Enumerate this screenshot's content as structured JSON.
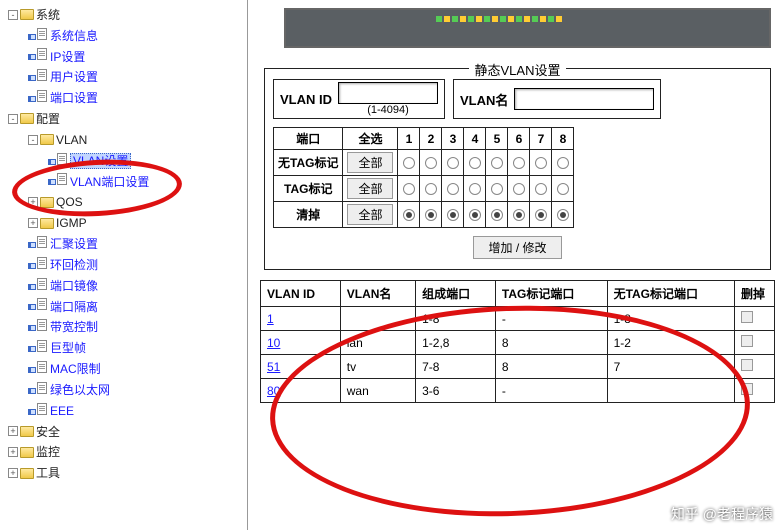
{
  "sidebar": {
    "nodes": [
      {
        "lvl": 0,
        "type": "folder",
        "toggle": "-",
        "label": "系统"
      },
      {
        "lvl": 1,
        "type": "page",
        "label": "系统信息"
      },
      {
        "lvl": 1,
        "type": "page",
        "label": "IP设置"
      },
      {
        "lvl": 1,
        "type": "page",
        "label": "用户设置"
      },
      {
        "lvl": 1,
        "type": "page",
        "label": "端口设置"
      },
      {
        "lvl": 0,
        "type": "folder",
        "toggle": "-",
        "label": "配置"
      },
      {
        "lvl": 1,
        "type": "folder",
        "toggle": "-",
        "label": "VLAN"
      },
      {
        "lvl": 2,
        "type": "page",
        "label": "VLAN设置",
        "selected": true
      },
      {
        "lvl": 2,
        "type": "page",
        "label": "VLAN端口设置"
      },
      {
        "lvl": 1,
        "type": "folder",
        "toggle": "+",
        "label": "QOS"
      },
      {
        "lvl": 1,
        "type": "folder",
        "toggle": "+",
        "label": "IGMP"
      },
      {
        "lvl": 1,
        "type": "page",
        "label": "汇聚设置"
      },
      {
        "lvl": 1,
        "type": "page",
        "label": "环回检测"
      },
      {
        "lvl": 1,
        "type": "page",
        "label": "端口镜像"
      },
      {
        "lvl": 1,
        "type": "page",
        "label": "端口隔离"
      },
      {
        "lvl": 1,
        "type": "page",
        "label": "带宽控制"
      },
      {
        "lvl": 1,
        "type": "page",
        "label": "巨型帧"
      },
      {
        "lvl": 1,
        "type": "page",
        "label": "MAC限制"
      },
      {
        "lvl": 1,
        "type": "page",
        "label": "绿色以太网"
      },
      {
        "lvl": 1,
        "type": "page",
        "label": "EEE"
      },
      {
        "lvl": 0,
        "type": "folder",
        "toggle": "+",
        "label": "安全"
      },
      {
        "lvl": 0,
        "type": "folder",
        "toggle": "+",
        "label": "监控"
      },
      {
        "lvl": 0,
        "type": "folder",
        "toggle": "+",
        "label": "工具"
      }
    ]
  },
  "panel": {
    "title": "静态VLAN设置",
    "vlanIdLabel": "VLAN ID",
    "vlanIdRange": "(1-4094)",
    "vlanNameLabel": "VLAN名",
    "portHeader": "端口",
    "selectAll": "全选",
    "ports": [
      "1",
      "2",
      "3",
      "4",
      "5",
      "6",
      "7",
      "8"
    ],
    "rows": [
      {
        "label": "无TAG标记",
        "btn": "全部",
        "checked": []
      },
      {
        "label": "TAG标记",
        "btn": "全部",
        "checked": []
      },
      {
        "label": "清掉",
        "btn": "全部",
        "checked": [
          "1",
          "2",
          "3",
          "4",
          "5",
          "6",
          "7",
          "8"
        ]
      }
    ],
    "addBtn": "增加 / 修改"
  },
  "list": {
    "headers": [
      "VLAN ID",
      "VLAN名",
      "组成端口",
      "TAG标记端口",
      "无TAG标记端口",
      "删掉"
    ],
    "rows": [
      {
        "id": "1",
        "name": "",
        "members": "1-8",
        "tag": "-",
        "untag": "1-8"
      },
      {
        "id": "10",
        "name": "lan",
        "members": "1-2,8",
        "tag": "8",
        "untag": "1-2"
      },
      {
        "id": "51",
        "name": "tv",
        "members": "7-8",
        "tag": "8",
        "untag": "7"
      },
      {
        "id": "80",
        "name": "wan",
        "members": "3-6",
        "tag": "-",
        "untag": ""
      }
    ]
  },
  "watermark": "知乎 @老程序猿"
}
